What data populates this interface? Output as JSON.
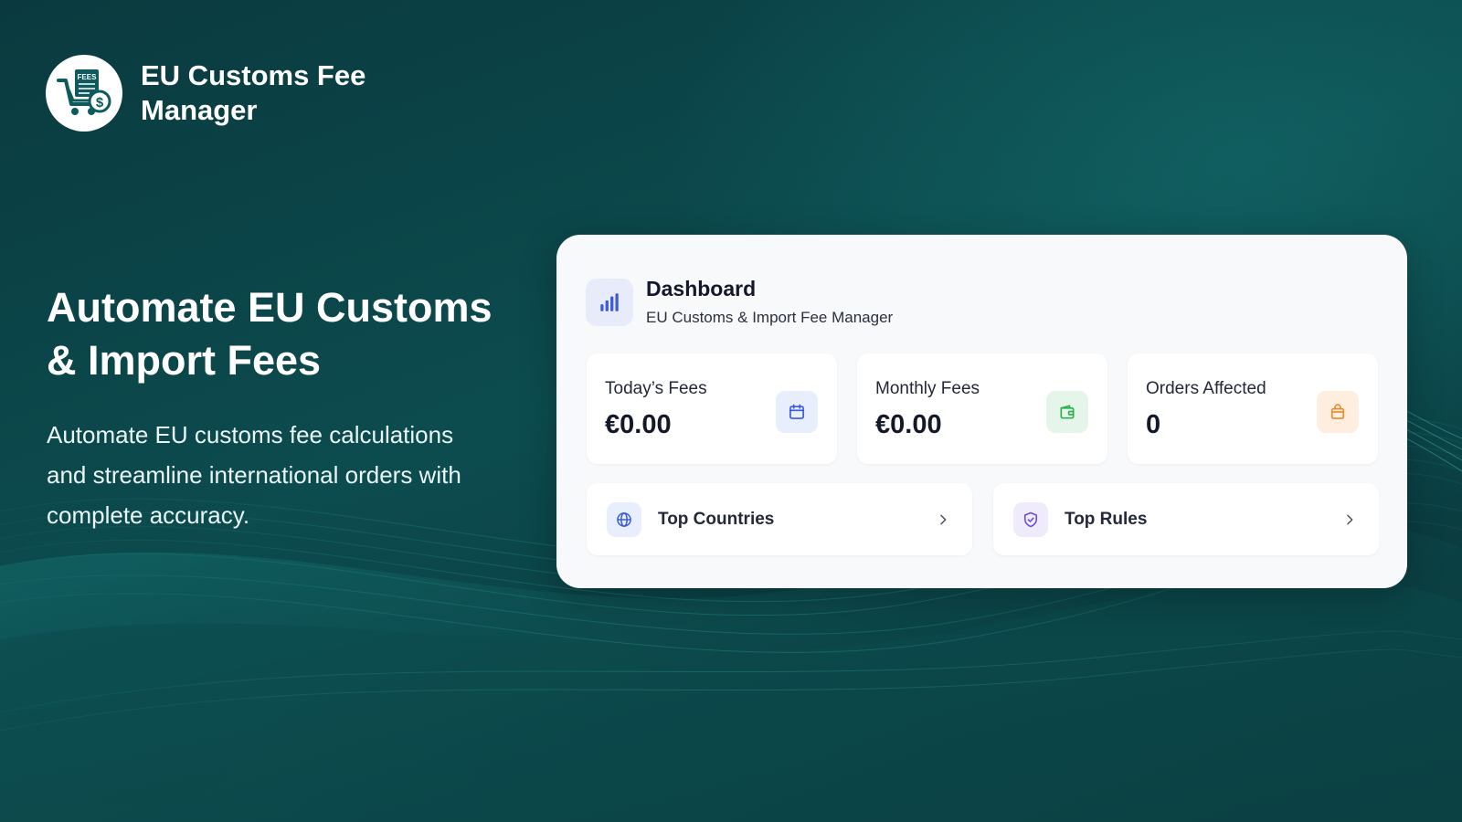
{
  "brand": {
    "name_line1": "EU Customs Fee",
    "name_line2": "Manager",
    "logo_text": "FEES",
    "logo_icon": "cart-fees-dollar-icon"
  },
  "hero": {
    "title_line1": "Automate EU Customs",
    "title_line2": "& Import Fees",
    "description": "Automate EU customs fee calculations and streamline international orders with complete accuracy."
  },
  "dashboard": {
    "title": "Dashboard",
    "subtitle": "EU Customs & Import Fee Manager",
    "icon": "bar-chart-icon",
    "stats": [
      {
        "label": "Today’s Fees",
        "value": "€0.00",
        "icon": "calendar-icon",
        "color": "#3b5bd9"
      },
      {
        "label": "Monthly Fees",
        "value": "€0.00",
        "icon": "wallet-icon",
        "color": "#2fae4f"
      },
      {
        "label": "Orders Affected",
        "value": "0",
        "icon": "shopping-bag-icon",
        "color": "#ef8a2c"
      }
    ],
    "links": [
      {
        "label": "Top Countries",
        "icon": "globe-icon",
        "color": "#3b5bd9"
      },
      {
        "label": "Top Rules",
        "icon": "shield-check-icon",
        "color": "#6a4fd0"
      }
    ]
  },
  "colors": {
    "background": "#0b3d40",
    "brand_teal": "#0e5a5c",
    "card_bg": "#f8f9fb"
  }
}
